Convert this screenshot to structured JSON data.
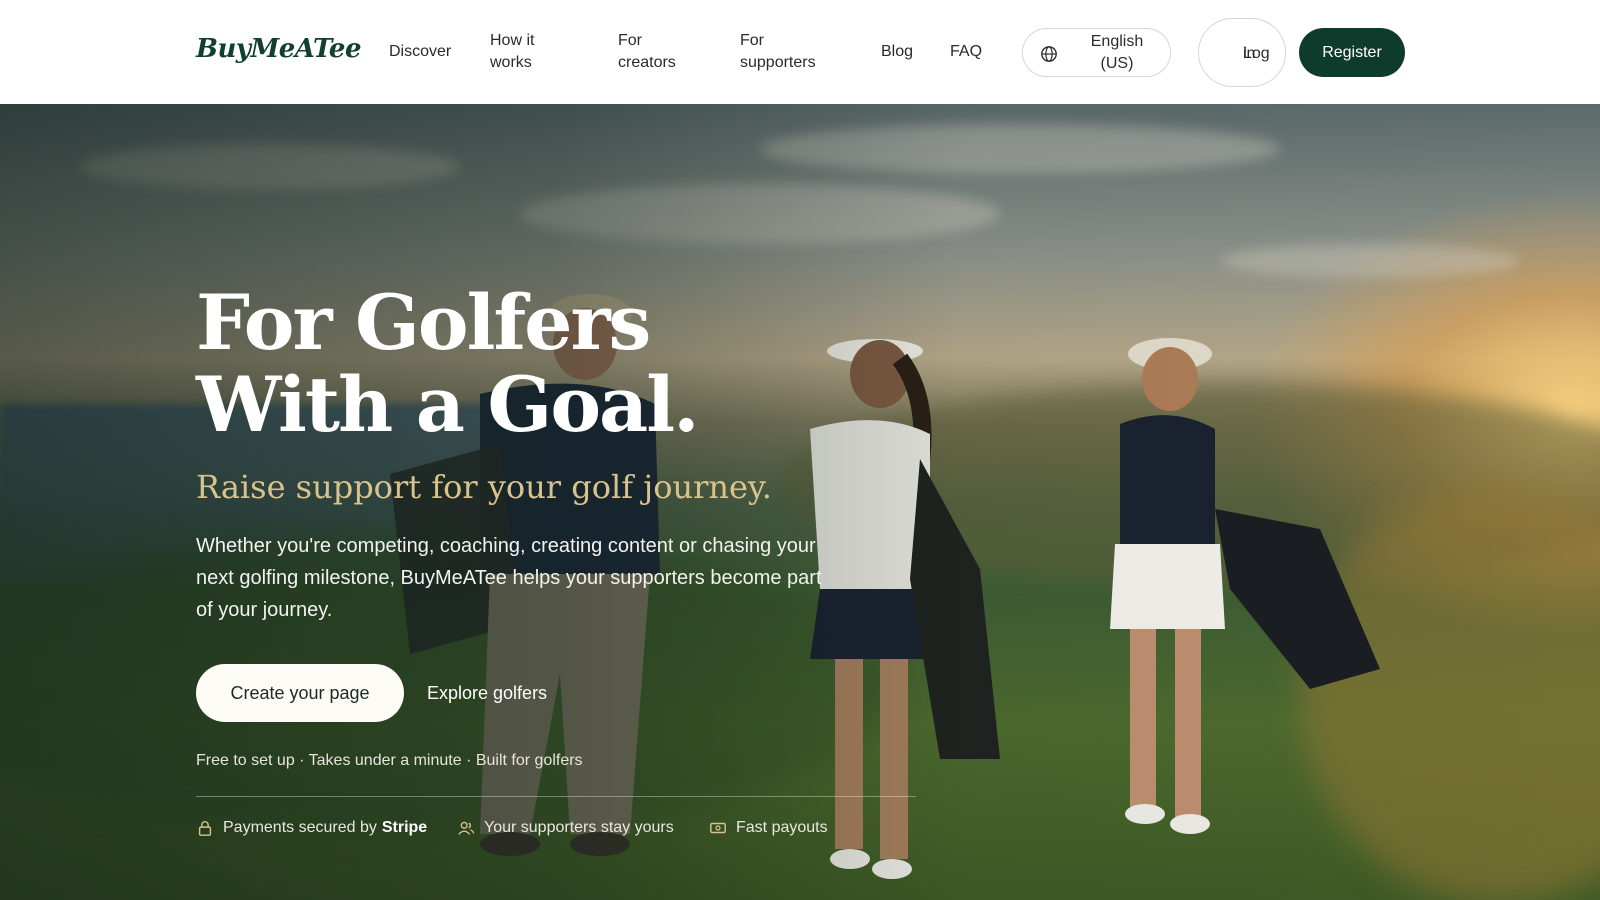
{
  "header": {
    "logo": "BuyMeATee",
    "nav": [
      {
        "label": "Discover",
        "line1": "Discover",
        "line2": ""
      },
      {
        "label": "How it works",
        "line1": "How it",
        "line2": "works"
      },
      {
        "label": "For creators",
        "line1": "For",
        "line2": "creators"
      },
      {
        "label": "For supporters",
        "line1": "For",
        "line2": "supporters"
      },
      {
        "label": "Blog",
        "line1": "Blog",
        "line2": ""
      },
      {
        "label": "FAQ",
        "line1": "FAQ",
        "line2": ""
      }
    ],
    "language": {
      "line1": "English",
      "line2": "(US)",
      "icon": "globe-icon"
    },
    "login": {
      "line1": "Log",
      "line2": "in"
    },
    "register": "Register"
  },
  "hero": {
    "title_line1": "For Golfers",
    "title_line2": "With a Goal.",
    "subtitle": "Raise support for your golf journey.",
    "description": "Whether you're competing, coaching, creating content or chasing your next golfing milestone, BuyMeATee helps your supporters become part of your journey.",
    "cta_primary": "Create your page",
    "cta_secondary": "Explore golfers",
    "note": "Free to set up · Takes under a minute · Built for golfers",
    "trust": [
      {
        "text": "Payments secured by",
        "strong": "Stripe",
        "icon": "lock-icon"
      },
      {
        "text": "Your supporters stay yours",
        "strong": "",
        "icon": "users-icon"
      },
      {
        "text": "Fast payouts",
        "strong": "",
        "icon": "cash-icon"
      }
    ]
  },
  "colors": {
    "brand": "#0f3b2c",
    "accent_gold": "#d9c38d",
    "white": "#ffffff"
  }
}
